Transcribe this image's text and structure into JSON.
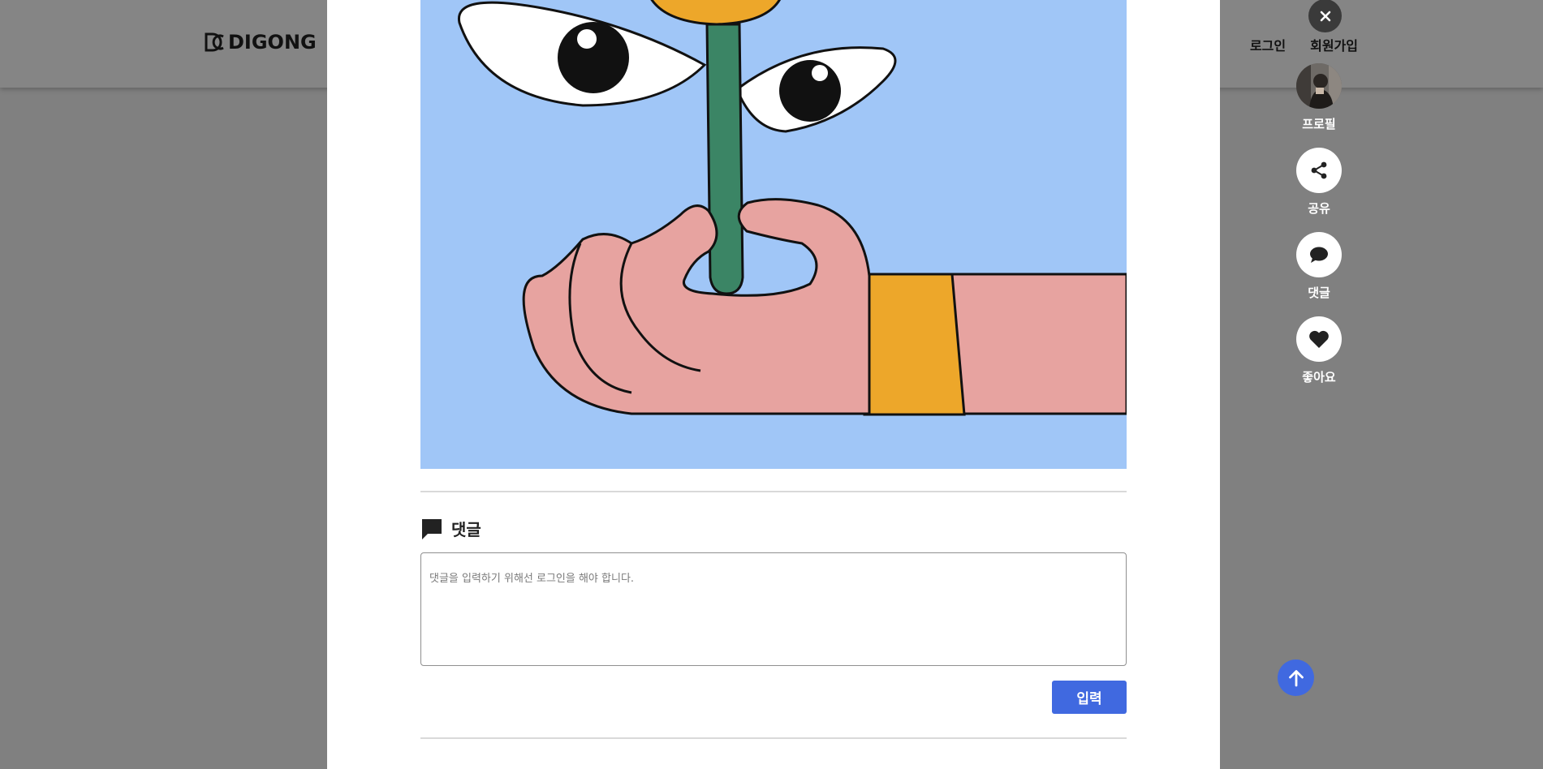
{
  "header": {
    "logo_text": "DIGONG",
    "login_label": "로그인",
    "signup_label": "회원가입"
  },
  "side_actions": {
    "profile_label": "프로필",
    "share_label": "공유",
    "comment_label": "댓글",
    "like_label": "좋아요"
  },
  "comments": {
    "title": "댓글",
    "placeholder": "댓글을 입력하기 위해선 로그인을 해야 합니다.",
    "submit_label": "입력"
  },
  "icons": {
    "close": "close-icon",
    "share": "share-icon",
    "comment": "speech-bubble-icon",
    "like": "heart-icon",
    "scroll_top": "arrow-up-icon",
    "comment_section": "chat-bubble-icon"
  },
  "colors": {
    "accent": "#4069e0",
    "overlay": "#808080",
    "artwork_sky": "#a0c6f7",
    "artwork_skin": "#e7a3a0",
    "artwork_stem": "#3b8565",
    "artwork_yellow": "#eda72a"
  }
}
